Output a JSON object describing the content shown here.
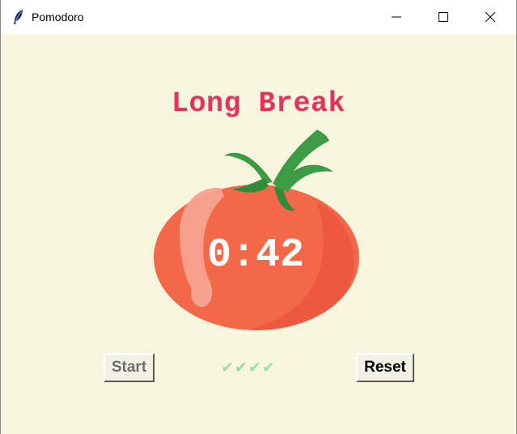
{
  "window": {
    "title": "Pomodoro",
    "icon": "feather-icon",
    "controls": [
      "minimize",
      "maximize",
      "close"
    ]
  },
  "timer_label": "Long Break",
  "timer_value": "0:42",
  "buttons": {
    "start_label": "Start",
    "reset_label": "Reset"
  },
  "checkmarks": "✔✔✔✔",
  "colors": {
    "background": "#f7f5dd",
    "heading": "#e7305b",
    "checkmarks": "#9bdeac",
    "tomato": "#f26849",
    "leaves": "#3c9c46"
  }
}
